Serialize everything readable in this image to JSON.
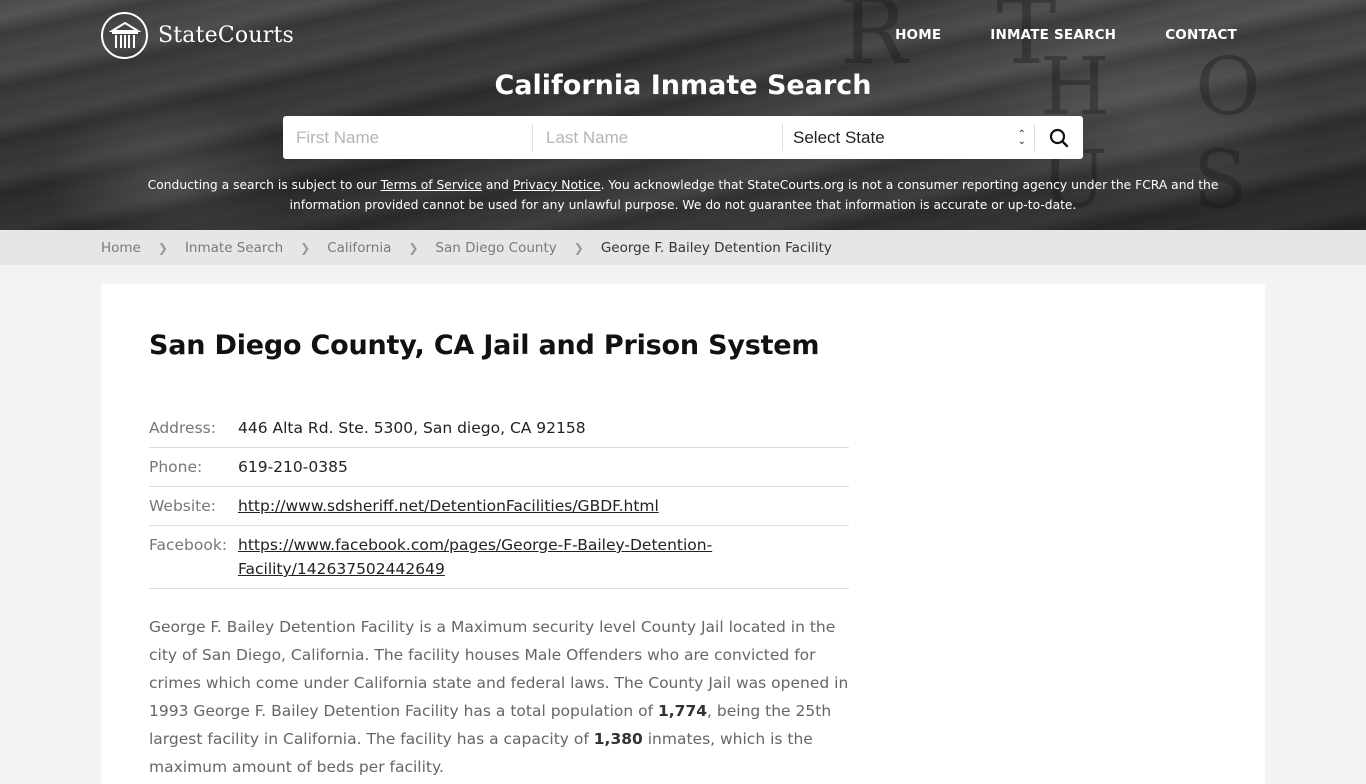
{
  "header": {
    "logo_text": "StateCourts",
    "nav": [
      {
        "label": "HOME"
      },
      {
        "label": "INMATE SEARCH"
      },
      {
        "label": "CONTACT"
      }
    ],
    "hero_title": "California Inmate Search",
    "search": {
      "first_name_placeholder": "First Name",
      "last_name_placeholder": "Last Name",
      "first_name_value": "",
      "last_name_value": "",
      "state_selected": "Select State",
      "search_icon": "search-icon"
    },
    "disclaimer": {
      "part1": "Conducting a search is subject to our ",
      "terms_link": "Terms of Service",
      "part2": " and ",
      "privacy_link": "Privacy Notice",
      "part3": ". You acknowledge that StateCourts.org is not a consumer reporting agency under the FCRA and the information provided cannot be used for any unlawful purpose. We do not guarantee that information is accurate or up-to-date."
    }
  },
  "breadcrumb": [
    {
      "label": "Home"
    },
    {
      "label": "Inmate Search"
    },
    {
      "label": "California"
    },
    {
      "label": "San Diego County"
    },
    {
      "label": "George F. Bailey Detention Facility"
    }
  ],
  "main": {
    "title": "San Diego County, CA Jail and Prison System",
    "info": {
      "address_label": "Address:",
      "address": "446 Alta Rd. Ste. 5300, San diego, CA 92158",
      "phone_label": "Phone:",
      "phone": "619-210-0385",
      "website_label": "Website:",
      "website": "http://www.sdsheriff.net/DetentionFacilities/GBDF.html",
      "facebook_label": "Facebook:",
      "facebook_line1": "https://www.facebook.com/pages/George-F-Bailey-Detention-",
      "facebook_line2": "Facility/142637502442649"
    },
    "description": {
      "part1": "George F. Bailey Detention Facility is a Maximum security level County Jail located in the city of San Diego, California. The facility houses Male Offenders who are convicted for crimes which come under California state and federal laws. The County Jail was opened in 1993 George F. Bailey Detention Facility has a total population of ",
      "population": "1,774",
      "part2": ", being the 25th largest facility in California. The facility has a capacity of ",
      "capacity": "1,380",
      "part3": " inmates, which is the maximum amount of beds per facility."
    }
  }
}
